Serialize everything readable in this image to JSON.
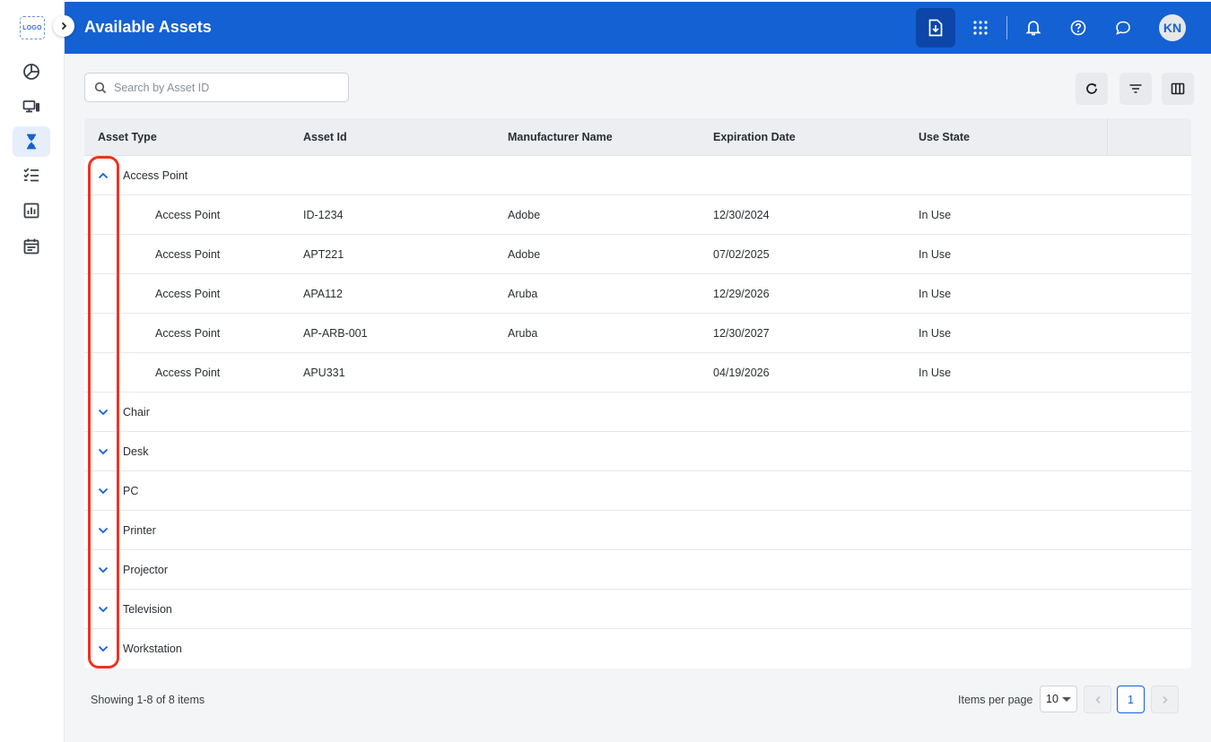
{
  "app": {
    "logo_text": "LOGO",
    "title": "Available Assets",
    "user_initials": "KN",
    "accent_color": "#1461d4",
    "highlight_color": "#f0321f"
  },
  "rail": {
    "items": [
      {
        "icon": "dashboard-pie-icon"
      },
      {
        "icon": "devices-icon"
      },
      {
        "icon": "hourglass-icon",
        "active": true
      },
      {
        "icon": "checklist-icon"
      },
      {
        "icon": "report-chart-icon"
      },
      {
        "icon": "calendar-icon"
      }
    ]
  },
  "topbar_actions": [
    "download-icon",
    "apps-grid-icon",
    "bell-icon",
    "help-icon",
    "chat-icon"
  ],
  "search": {
    "placeholder": "Search by Asset ID"
  },
  "toolbar": [
    "refresh-icon",
    "filter-icon",
    "columns-icon"
  ],
  "table": {
    "columns": [
      "Asset Type",
      "Asset Id",
      "Manufacturer Name",
      "Expiration Date",
      "Use State"
    ],
    "groups": [
      {
        "label": "Access Point",
        "expanded": true,
        "rows": [
          [
            "Access Point",
            "ID-1234",
            "Adobe",
            "12/30/2024",
            "In Use"
          ],
          [
            "Access Point",
            "APT221",
            "Adobe",
            "07/02/2025",
            "In Use"
          ],
          [
            "Access Point",
            "APA112",
            "Aruba",
            "12/29/2026",
            "In Use"
          ],
          [
            "Access Point",
            "AP-ARB-001",
            "Aruba",
            "12/30/2027",
            "In Use"
          ],
          [
            "Access Point",
            "APU331",
            "",
            "04/19/2026",
            "In Use"
          ]
        ]
      },
      {
        "label": "Chair",
        "expanded": false
      },
      {
        "label": "Desk",
        "expanded": false
      },
      {
        "label": "PC",
        "expanded": false
      },
      {
        "label": "Printer",
        "expanded": false
      },
      {
        "label": "Projector",
        "expanded": false
      },
      {
        "label": "Television",
        "expanded": false
      },
      {
        "label": "Workstation",
        "expanded": false
      }
    ]
  },
  "footer": {
    "showing": "Showing 1-8 of 8 items",
    "items_per_page_label": "Items per page",
    "items_per_page": "10",
    "current_page": "1"
  }
}
